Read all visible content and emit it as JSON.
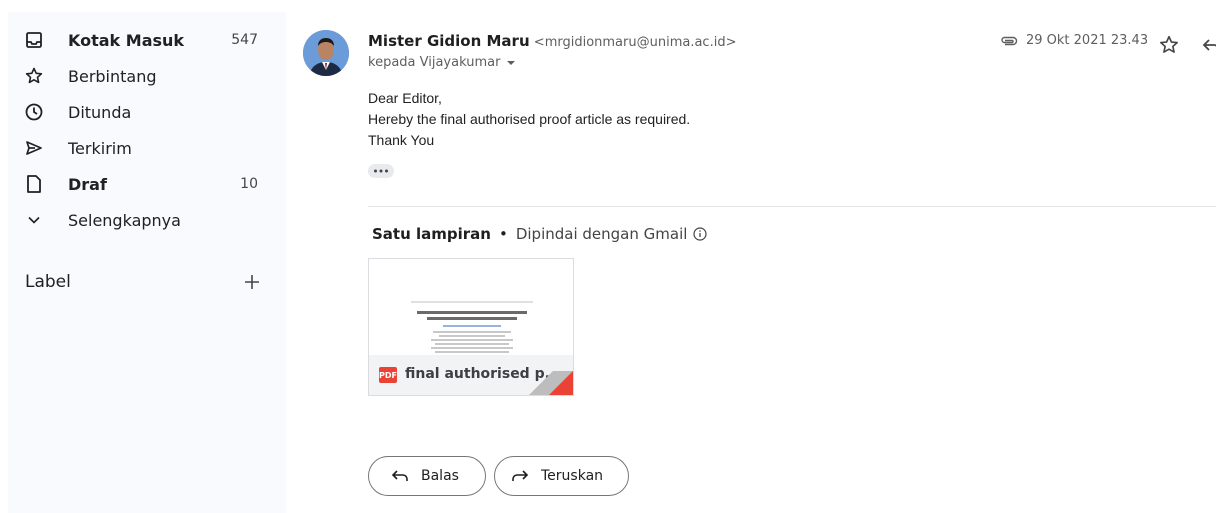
{
  "sidebar": {
    "items": [
      {
        "label": "Kotak Masuk",
        "count": "547",
        "icon": "inbox-icon"
      },
      {
        "label": "Berbintang",
        "count": "",
        "icon": "star-icon"
      },
      {
        "label": "Ditunda",
        "count": "",
        "icon": "clock-icon"
      },
      {
        "label": "Terkirim",
        "count": "",
        "icon": "send-icon"
      },
      {
        "label": "Draf",
        "count": "10",
        "icon": "draft-icon"
      },
      {
        "label": "Selengkapnya",
        "count": "",
        "icon": "chevron-down-icon"
      }
    ],
    "label_heading": "Label",
    "add_label_glyph": "+"
  },
  "message": {
    "sender_name": "Mister Gidion Maru",
    "sender_email": "<mrgidionmaru@unima.ac.id>",
    "to_line": "kepada Vijayakumar",
    "date": "29 Okt 2021 23.43",
    "body": [
      "Dear Editor,",
      "Hereby the final authorised proof article as required.",
      "Thank You"
    ],
    "ellipsis": "•••"
  },
  "attachments": {
    "heading": "Satu lampiran",
    "separator": "•",
    "scanned": "Dipindai dengan Gmail",
    "file_name": "final authorised p...",
    "file_type": "PDF"
  },
  "actions": {
    "reply_label": "Balas",
    "forward_label": "Teruskan"
  },
  "colors": {
    "sidebar_bg": "#f8fafd",
    "pdf_red": "#ea4335",
    "border": "#747775"
  }
}
